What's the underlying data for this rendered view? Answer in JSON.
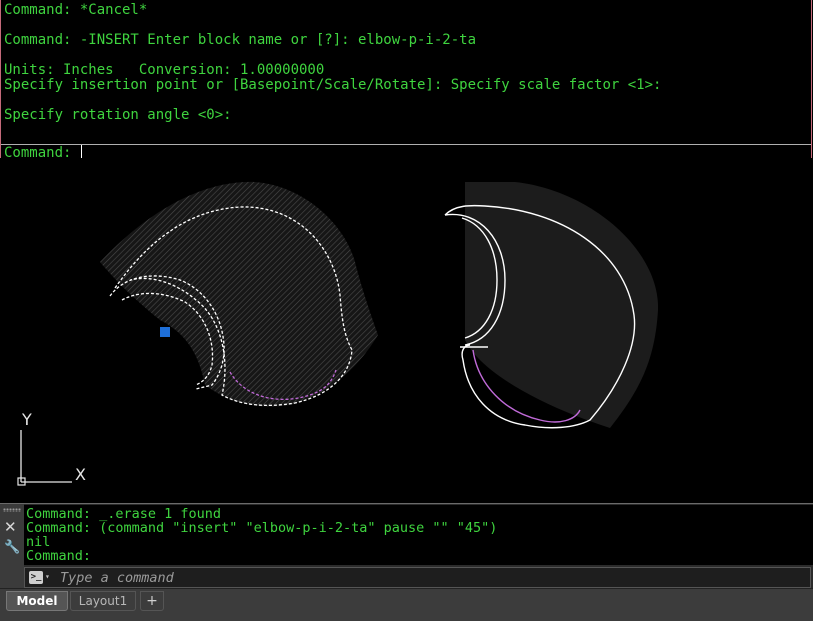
{
  "text_window": {
    "lines": [
      "Command: *Cancel*",
      "Command: -INSERT Enter block name or [?]: elbow-p-i-2-ta",
      "Units: Inches   Conversion: 1.00000000",
      "Specify insertion point or [Basepoint/Scale/Rotate]: Specify scale factor <1>:",
      "Specify rotation angle <0>:",
      "Command:"
    ]
  },
  "canvas": {
    "ucs_x_label": "X",
    "ucs_y_label": "Y",
    "grip_color": "#1e6fd9",
    "geometry_color": "#ffffff",
    "accent_curve_color": "#c06ad8"
  },
  "command_line": {
    "history": [
      "Command: _.erase 1 found",
      "Command: (command \"insert\" \"elbow-p-i-2-ta\" pause \"\" \"45\")",
      "nil",
      "Command:"
    ],
    "input_value": "",
    "placeholder": "Type a command",
    "close_glyph": "✕",
    "customize_glyph": "🔧",
    "prompt_glyph": ">_",
    "prompt_arrow_glyph": "▾"
  },
  "layout_tabs": {
    "model": "Model",
    "layout1": "Layout1",
    "add": "+"
  }
}
